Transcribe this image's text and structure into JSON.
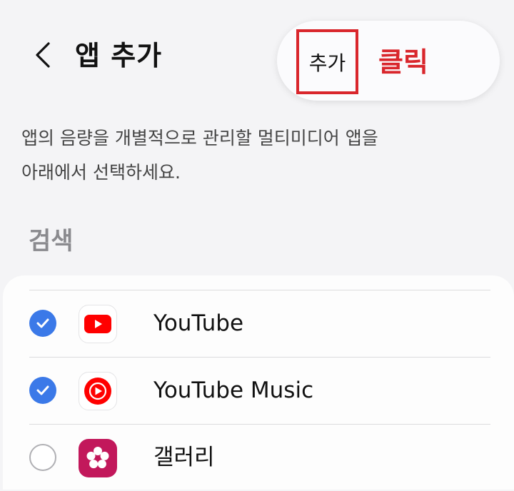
{
  "header": {
    "title": "앱 추가",
    "add_label": "추가",
    "click_annotation": "클릭"
  },
  "description": {
    "line1": "앱의 음량을 개별적으로 관리할 멀티미디어 앱을",
    "line2": "아래에서 선택하세요."
  },
  "section_title": "검색",
  "apps": [
    {
      "name": "YouTube",
      "checked": true,
      "icon": "youtube-icon"
    },
    {
      "name": "YouTube Music",
      "checked": true,
      "icon": "youtube-music-icon"
    },
    {
      "name": "갤러리",
      "checked": false,
      "icon": "gallery-icon"
    }
  ],
  "colors": {
    "accent_blue": "#3b79e8",
    "annotation_red": "#d9262c",
    "youtube_red": "#ff0000",
    "gallery_pink": "#c2185b"
  }
}
